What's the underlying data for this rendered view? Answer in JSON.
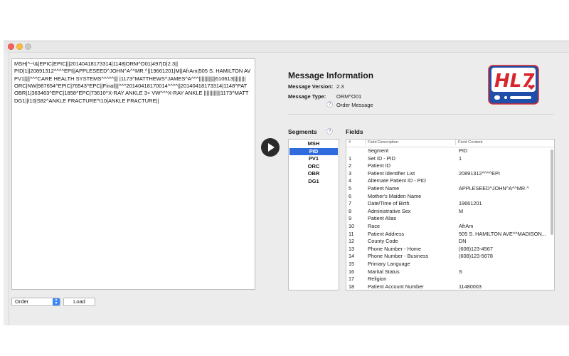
{
  "message_text": [
    "MSH|^~\\&|EPIC|EPIC|||20140418173314|1148|ORM^O01|497|D|2.3||",
    "PID|1||20891312^^^^EPI||APPLESEED^JOHN^A^^MR.^||19661201|M||AfrAm|505 S. HAMILTON AV",
    "PV1||||^^^CARE HEALTH SYSTEMS^^^^^||| |1173^MATTHEWS^JAMES^A^^^||||||||||||610613|||||||||",
    "ORC|NW|987654^EPIC|76543^EPC||Final|||^^^20140418170014^^^^||20140418173314|1148^PAT",
    "OBR|1|363463^EPC|1858^EPC|73610^X-RAY ANKLE 3+ VW^^^X-RAY ANKLE ||||||||||||1173^MATT",
    "DG1||I10|S82^ANKLE FRACTURE^I10|ANKLE FRACTURE||"
  ],
  "controls": {
    "type_select": "Order",
    "load_button": "Load"
  },
  "info": {
    "title": "Message Information",
    "version_label": "Message Version:",
    "version_value": "2.3",
    "type_label": "Message Type:",
    "type_value": "ORM^O01",
    "type_desc": "Order Message",
    "help_glyph": "?"
  },
  "logo": {
    "text": "HL7",
    "accent": "#d9262c",
    "brand": "#1f4fa8"
  },
  "segments": {
    "title": "Segments",
    "items": [
      "MSH",
      "PID",
      "PV1",
      "ORC",
      "OBR",
      "DG1"
    ],
    "selected": "PID"
  },
  "fields": {
    "title": "Fields",
    "headers": [
      "#",
      "Field Description",
      "Field Content"
    ],
    "rows": [
      [
        "",
        "Segment",
        "PID"
      ],
      [
        "1",
        "Set ID - PID",
        "1"
      ],
      [
        "2",
        "Patient ID",
        ""
      ],
      [
        "3",
        "Patient Identifier List",
        "20891312^^^^EPI"
      ],
      [
        "4",
        "Alternate Patient ID - PID",
        ""
      ],
      [
        "5",
        "Patient Name",
        "APPLESEED^JOHN^A^^MR.^"
      ],
      [
        "6",
        "Mother's Maiden Name",
        ""
      ],
      [
        "7",
        "Date/Time of Birth",
        "19661201"
      ],
      [
        "8",
        "Administrative Sex",
        "M"
      ],
      [
        "9",
        "Patient Alias",
        ""
      ],
      [
        "10",
        "Race",
        "AfrAm"
      ],
      [
        "11",
        "Patient Address",
        "505 S. HAMILTON AVE^^MADISON..."
      ],
      [
        "12",
        "County Code",
        "DN"
      ],
      [
        "13",
        "Phone Number - Home",
        "(608)123-4567"
      ],
      [
        "14",
        "Phone Number - Business",
        "(608)123-5678"
      ],
      [
        "15",
        "Primary Language",
        ""
      ],
      [
        "16",
        "Marital Status",
        "S"
      ],
      [
        "17",
        "Religion",
        ""
      ],
      [
        "18",
        "Patient Account Number",
        "11480003"
      ]
    ]
  },
  "colors": {
    "selection": "#2f6bdc",
    "play": "#2b2b2b"
  }
}
